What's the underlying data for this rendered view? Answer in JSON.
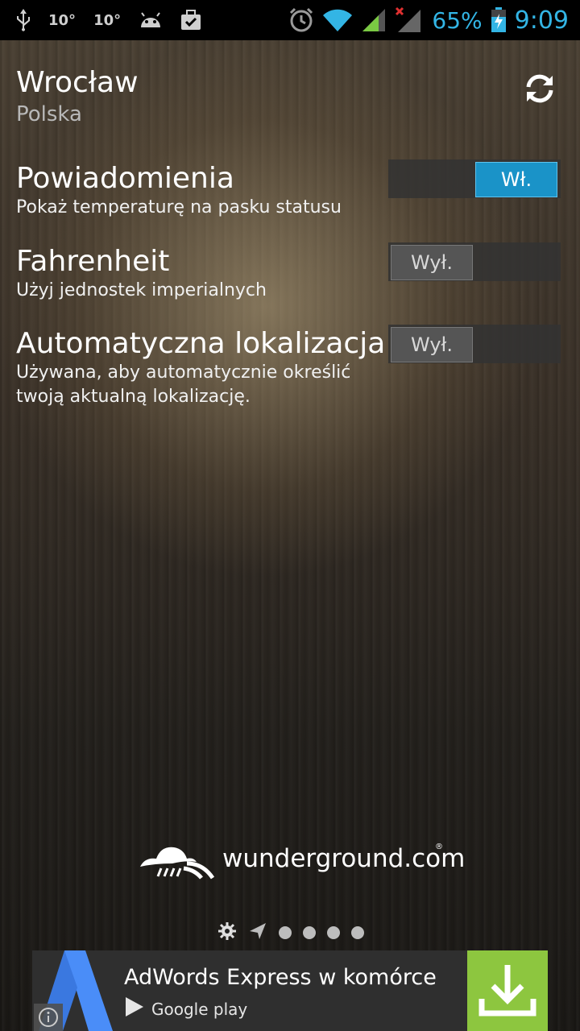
{
  "status_bar": {
    "left_icons": [
      "usb-icon",
      "temperature-icon",
      "temperature-icon",
      "android-icon",
      "briefcase-icon"
    ],
    "temp1": "10°",
    "temp2": "10°",
    "right_icons": [
      "alarm-icon",
      "wifi-icon",
      "signal-icon",
      "signal-no-data-icon",
      "battery-charging-icon"
    ],
    "battery": "65%",
    "time": "9:09"
  },
  "location": {
    "city": "Wrocław",
    "country": "Polska"
  },
  "settings": [
    {
      "title": "Powiadomienia",
      "desc": "Pokaż temperaturę na pasku statusu",
      "state": "on",
      "toggle_label": "Wł."
    },
    {
      "title": "Fahrenheit",
      "desc": "Użyj jednostek imperialnych",
      "state": "off",
      "toggle_label": "Wył."
    },
    {
      "title": "Automatyczna lokalizacja",
      "desc": "Używana, aby automatycznie określić twoją aktualną lokalizację.",
      "state": "off",
      "toggle_label": "Wył."
    }
  ],
  "branding": {
    "logo_text": "wunderground.com"
  },
  "pager": {
    "icons": [
      "gear-icon",
      "navigation-arrow-icon"
    ],
    "dots": 4
  },
  "ad": {
    "title": "AdWords Express w komórce",
    "store": "Google play"
  },
  "colors": {
    "accent": "#33b5e5",
    "toggle_on": "#1a93c8",
    "download_button": "#8dc63f"
  }
}
